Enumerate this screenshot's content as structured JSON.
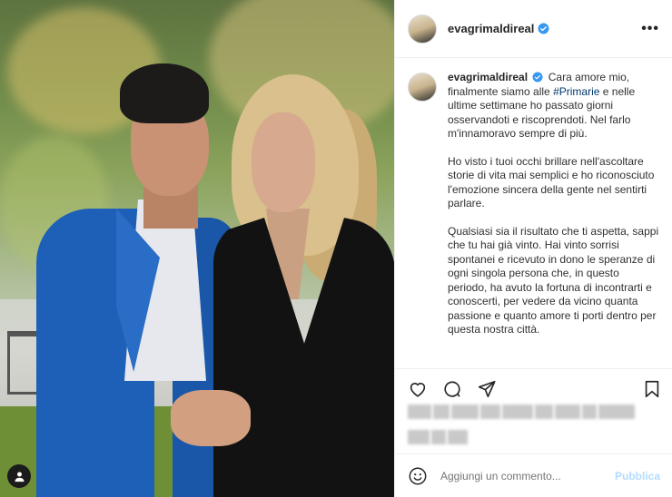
{
  "post": {
    "username": "evagrimaldireal",
    "verified": true,
    "more_label": "•••"
  },
  "caption": {
    "username": "evagrimaldireal",
    "p1_before": "Cara amore mio, finalmente siamo alle ",
    "p1_hashtag": "#Primarie",
    "p1_after": " e nelle ultime settimane ho passato giorni osservandoti e riscoprendoti. Nel farlo m'innamoravo sempre di più.",
    "p2": "Ho visto i tuoi occhi brillare nell'ascoltare storie di vita mai semplici e ho riconosciuto l'emozione sincera della gente nel sentirti parlare.",
    "p3": "Qualsiasi sia il risultato che ti aspetta, sappi che tu hai già vinto. Hai vinto sorrisi spontanei e ricevuto in dono le speranze di ogni singola persona che, in questo periodo, ha avuto la fortuna di incontrarti e conoscerti, per vedere da vicino quanta passione e quanto amore ti porti dentro per questa nostra città."
  },
  "comment": {
    "placeholder": "Aggiungi un commento...",
    "publish_label": "Pubblica"
  },
  "icons": {
    "like": "heart-icon",
    "comment": "comment-icon",
    "share": "send-icon",
    "save": "bookmark-icon",
    "emoji": "emoji-icon",
    "profile_badge": "user-icon"
  },
  "colors": {
    "verified_blue": "#3897f0",
    "hashtag": "#00376b",
    "publish_disabled": "#b3dbff",
    "jacket": "#1e60b8"
  }
}
